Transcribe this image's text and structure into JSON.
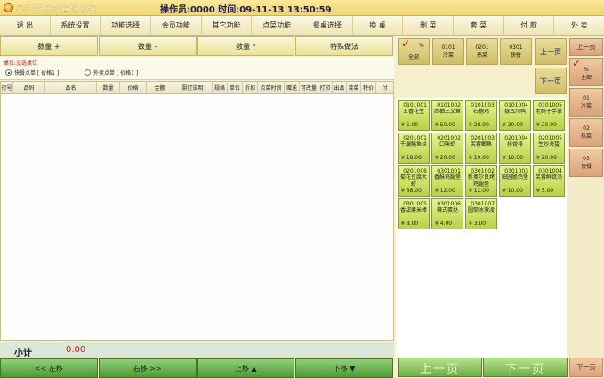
{
  "titlebar": {
    "app_title": "渠世家餐饮管理系统",
    "status": "操作员:0000 时间:09-11-13 13:50:59"
  },
  "menu": [
    "退 出",
    "系统设置",
    "功能选择",
    "会员功能",
    "其它功能",
    "点菜功能",
    "餐桌选择",
    "换 桌",
    "删 菜",
    "套 菜",
    "付 款",
    "外 卖"
  ],
  "quantity_buttons": [
    "数量 +",
    "数量 -",
    "数量 *",
    "特殊做法"
  ],
  "order": {
    "table_label": "桌位:没选桌位",
    "options": [
      {
        "label": "快餐点单 [ 价格1 ]",
        "selected": true
      },
      {
        "label": "外卖点单 [ 价格1 ]",
        "selected": false
      }
    ]
  },
  "table_columns": [
    "行号",
    "品码",
    "品名",
    "数量",
    "价格",
    "金额",
    "厨打说明",
    "规格",
    "单位",
    "折扣",
    "点菜时间",
    "赠送",
    "可改量",
    "打印",
    "出品",
    "套菜",
    "特价",
    "付"
  ],
  "subtotal": {
    "label": "小计",
    "value": "0.00"
  },
  "bottom_nav": [
    "<< 左移",
    "右移 >>",
    "上移 ▲",
    "下移 ▼"
  ],
  "categories": {
    "all": {
      "label": "全部",
      "pct": "%"
    },
    "items": [
      {
        "code": "0101",
        "name": "冷菜"
      },
      {
        "code": "0201",
        "name": "热菜"
      },
      {
        "code": "0301",
        "name": "快餐"
      }
    ],
    "prev": "上一页",
    "next": "下一页"
  },
  "dishes": [
    {
      "code": "0101001",
      "name": "五香花生",
      "price": "¥ 5.00"
    },
    {
      "code": "0101002",
      "name": "西柚三文鱼",
      "price": "¥ 50.00"
    },
    {
      "code": "0101003",
      "name": "石榴鸡",
      "price": "¥ 28.00"
    },
    {
      "code": "0101004",
      "name": "银耳川鸭",
      "price": "¥ 20.00"
    },
    {
      "code": "0101005",
      "name": "老妈子手掌",
      "price": "¥ 20.00"
    },
    {
      "code": "0201001",
      "name": "干煸鳝鱼丝",
      "price": "¥ 18.00"
    },
    {
      "code": "0201002",
      "name": "口味虾",
      "price": "¥ 20.00"
    },
    {
      "code": "0201003",
      "name": "芙蓉鲫鱼",
      "price": "¥ 19.00"
    },
    {
      "code": "0201004",
      "name": "排骨排",
      "price": "¥ 10.00"
    },
    {
      "code": "0201005",
      "name": "生炒海蛰",
      "price": "¥ 20.00"
    },
    {
      "code": "0201006",
      "name": "菊花豆腐大虾",
      "price": "¥ 38.00"
    },
    {
      "code": "0301001",
      "name": "香酥鸡腿堡",
      "price": "¥ 12.00"
    },
    {
      "code": "0301002",
      "name": "新奥尔良烤鸡腿堡",
      "price": "¥ 12.00"
    },
    {
      "code": "0301003",
      "name": "田园脆鸡堡",
      "price": "¥ 10.00"
    },
    {
      "code": "0301004",
      "name": "芙蓉鲜蔬汤",
      "price": "¥ 5.00"
    },
    {
      "code": "0301005",
      "name": "香甜栗米棒",
      "price": "¥ 8.00"
    },
    {
      "code": "0301006",
      "name": "辣式蛋挞",
      "price": "¥ 4.00"
    },
    {
      "code": "0301007",
      "name": "圆筒冰激凌",
      "price": "¥ 3.00"
    }
  ],
  "page_buttons": {
    "prev": "上一页",
    "next": "下一页"
  },
  "sidebar": {
    "prev": "上一页",
    "all": {
      "label": "全部",
      "pct": "%"
    },
    "items": [
      {
        "code": "01",
        "name": "冷菜"
      },
      {
        "code": "02",
        "name": "热菜"
      },
      {
        "code": "03",
        "name": "快餐"
      }
    ],
    "next": "下一页"
  }
}
